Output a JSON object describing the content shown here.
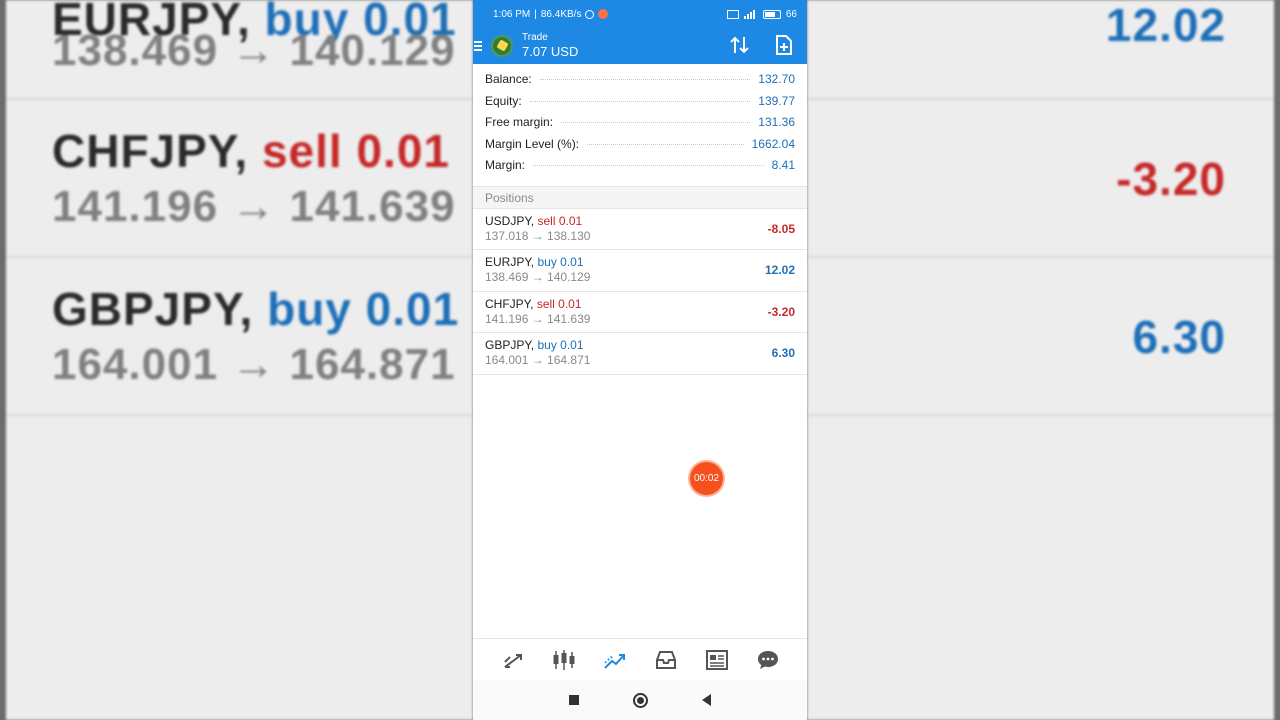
{
  "status_bar": {
    "time": "1:06 PM",
    "speed": "86.4KB/s",
    "battery": "66"
  },
  "header": {
    "title": "Trade",
    "subtitle": "7.07 USD"
  },
  "summary": [
    {
      "label": "Balance:",
      "value": "132.70"
    },
    {
      "label": "Equity:",
      "value": "139.77"
    },
    {
      "label": "Free margin:",
      "value": "131.36"
    },
    {
      "label": "Margin Level (%):",
      "value": "1662.04"
    },
    {
      "label": "Margin:",
      "value": "8.41"
    }
  ],
  "positions_header": "Positions",
  "positions": [
    {
      "symbol": "USDJPY,",
      "side": "sell 0.01",
      "prices": "137.018 → 138.130",
      "profit": "-8.05"
    },
    {
      "symbol": "EURJPY,",
      "side": "buy 0.01",
      "prices": "138.469 → 140.129",
      "profit": "12.02"
    },
    {
      "symbol": "CHFJPY,",
      "side": "sell 0.01",
      "prices": "141.196 → 141.639",
      "profit": "-3.20"
    },
    {
      "symbol": "GBPJPY,",
      "side": "buy 0.01",
      "prices": "164.001 → 164.871",
      "profit": "6.30"
    }
  ],
  "background_left": [
    {
      "symbol": "EURJPY,",
      "side": "buy 0.01",
      "prices": "138.469 → 140.129"
    },
    {
      "symbol": "CHFJPY,",
      "side": "sell 0.01",
      "prices": "141.196 → 141.639"
    },
    {
      "symbol": "GBPJPY,",
      "side": "buy 0.01",
      "prices": "164.001 → 164.871"
    }
  ],
  "background_right": [
    {
      "value": "12.02"
    },
    {
      "value": "-3.20"
    },
    {
      "value": "6.30"
    }
  ],
  "timer": "00:02",
  "colors": {
    "accent": "#1e88e5",
    "sell": "#c62828",
    "buy": "#1e6fb7"
  },
  "icons": {
    "bottom_nav": [
      "quotes-icon",
      "chart-icon",
      "trade-icon",
      "history-icon",
      "news-icon",
      "chat-icon"
    ]
  }
}
